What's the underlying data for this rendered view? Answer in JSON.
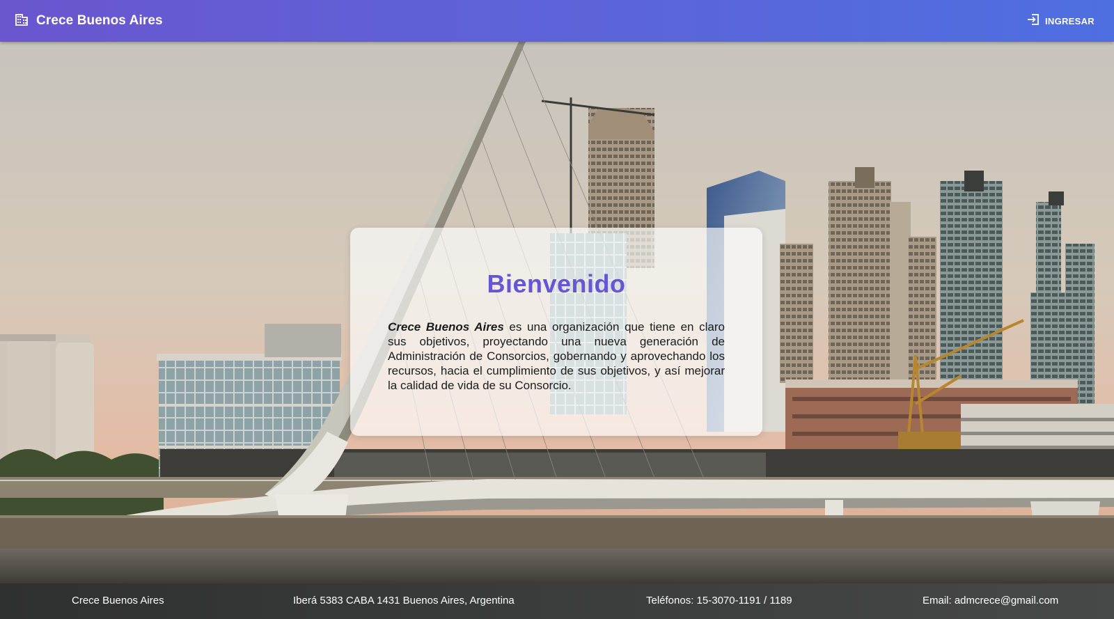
{
  "header": {
    "brand_icon": "building-icon",
    "brand_title": "Crece Buenos Aires",
    "login_icon": "login-icon",
    "login_label": "INGRESAR"
  },
  "welcome": {
    "title": "Bienvenido",
    "org_name": "Crece Buenos Aires",
    "body": " es una organización que tiene en claro sus objetivos, proyectando una nueva generación de Administración de Consorcios, gobernando y aprovechando los recursos, hacia el cumplimiento de sus objetivos, y así mejorar la calidad de vida de su Consorcio."
  },
  "footer": {
    "name": "Crece Buenos Aires",
    "address": "Iberá 5383 CABA 1431 Buenos Aires, Argentina",
    "phones": "Teléfonos: 15-3070-1191 / 1189",
    "email": "Email: admcrece@gmail.com"
  },
  "colors": {
    "header_start": "#6a56cf",
    "header_end": "#4e6fe0",
    "title": "#6656d4",
    "footer": "#3b3c3c"
  }
}
